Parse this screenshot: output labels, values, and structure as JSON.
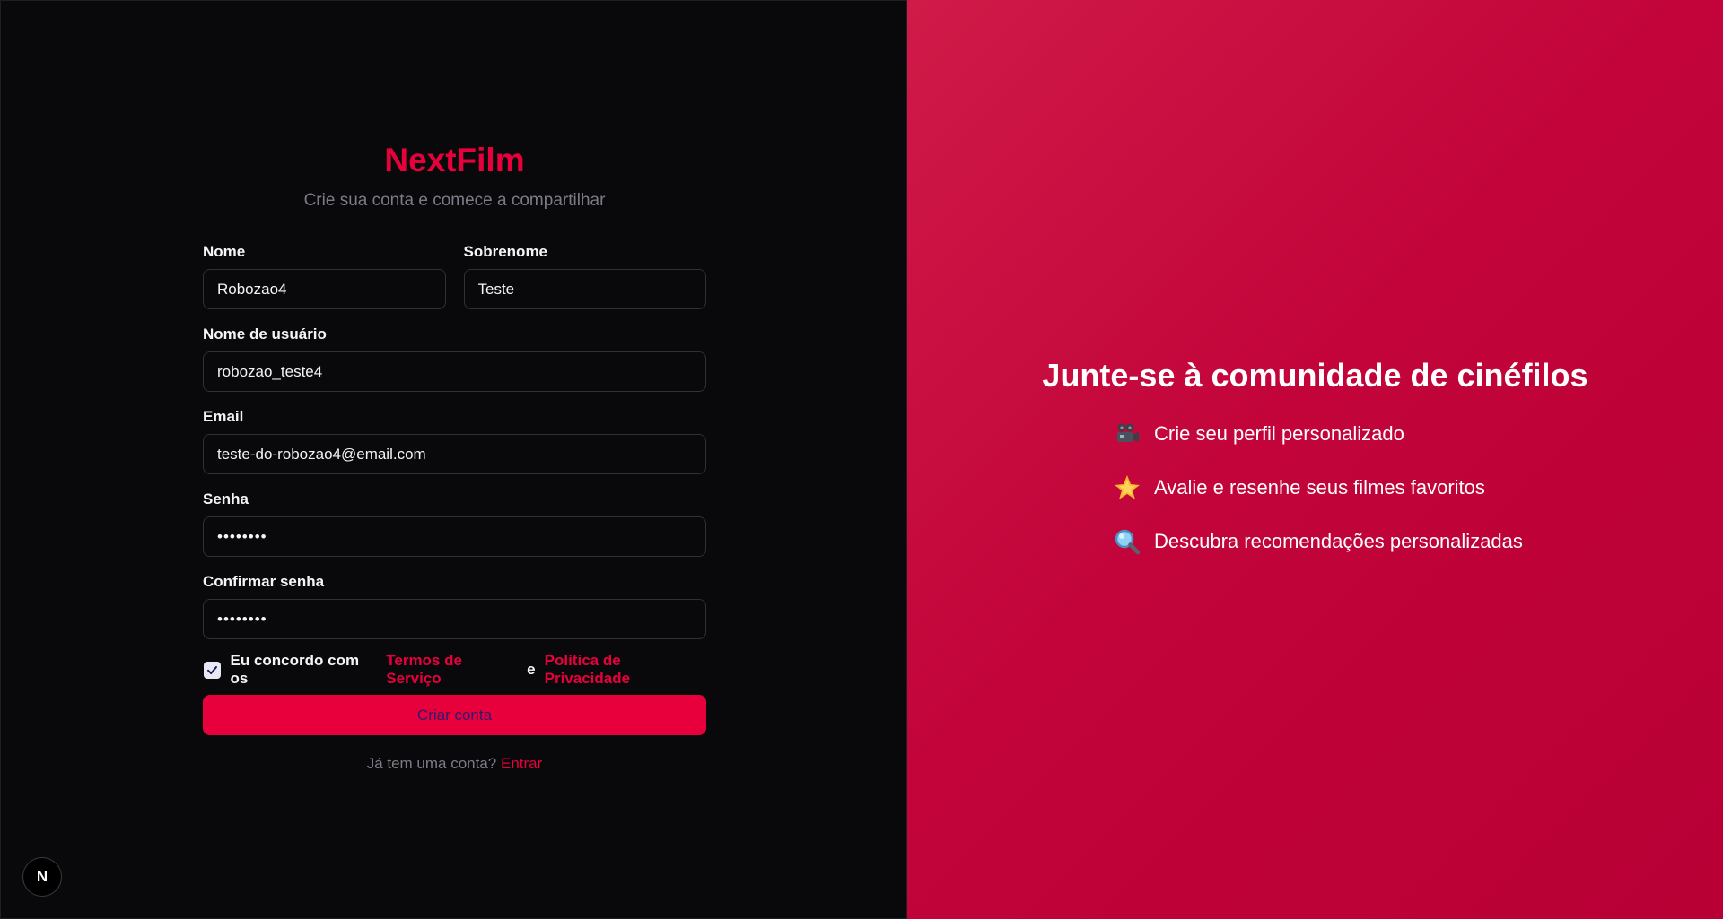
{
  "brand": {
    "title": "NextFilm",
    "subtitle": "Crie sua conta e comece a compartilhar"
  },
  "form": {
    "first_name": {
      "label": "Nome",
      "value": "Robozao4"
    },
    "last_name": {
      "label": "Sobrenome",
      "value": "Teste"
    },
    "username": {
      "label": "Nome de usuário",
      "value": "robozao_teste4"
    },
    "email": {
      "label": "Email",
      "value": "teste-do-robozao4@email.com"
    },
    "password": {
      "label": "Senha",
      "value": "••••••••"
    },
    "confirm_password": {
      "label": "Confirmar senha",
      "value": "••••••••"
    },
    "terms": {
      "checked": true,
      "prefix": "Eu concordo com os",
      "terms_link": "Termos de Serviço",
      "conjunction": "e",
      "privacy_link": "Política de Privacidade"
    },
    "submit_label": "Criar conta",
    "signin_prompt": "Já tem uma conta?",
    "signin_link": "Entrar"
  },
  "badge": {
    "letter": "N"
  },
  "promo": {
    "title": "Junte-se à comunidade de cinéfilos",
    "features": [
      {
        "icon": "camera-icon",
        "text": "Crie seu perfil personalizado"
      },
      {
        "icon": "star-icon",
        "text": "Avalie e resenhe seus filmes favoritos"
      },
      {
        "icon": "magnifier-icon",
        "text": "Descubra recomendações personalizadas"
      }
    ]
  },
  "colors": {
    "accent": "#e8003d",
    "left_background": "#09090b",
    "right_background": "#c2043a"
  }
}
